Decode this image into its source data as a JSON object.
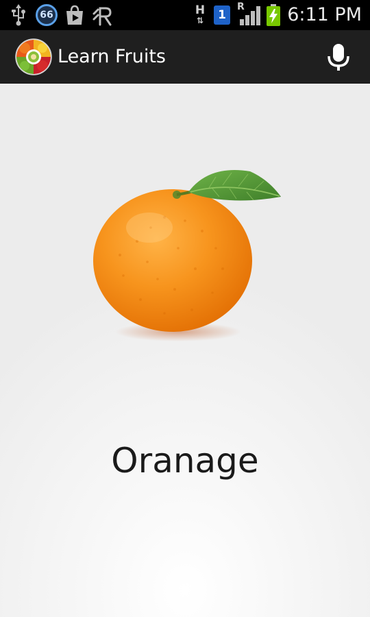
{
  "status_bar": {
    "time": "6:11 PM",
    "badge_66": "66",
    "sim_slot": "1",
    "network_type": "H",
    "roaming": "R",
    "icons": [
      "usb-icon",
      "badge-66-icon",
      "play-store-icon",
      "app-r-icon",
      "network-h-icon",
      "sim-1-icon",
      "signal-icon",
      "battery-charging-icon"
    ]
  },
  "action_bar": {
    "title": "Learn Fruits",
    "icons": [
      "app-logo-icon",
      "microphone-icon"
    ]
  },
  "main": {
    "fruit_name": "Oranage",
    "fruit_image": "orange-with-leaf-image"
  },
  "colors": {
    "status_bar_bg": "#000000",
    "action_bar_bg": "#1f1f1f",
    "sim_badge": "#1e62c8",
    "battery_green": "#78c800",
    "orange": "#f7941d"
  }
}
